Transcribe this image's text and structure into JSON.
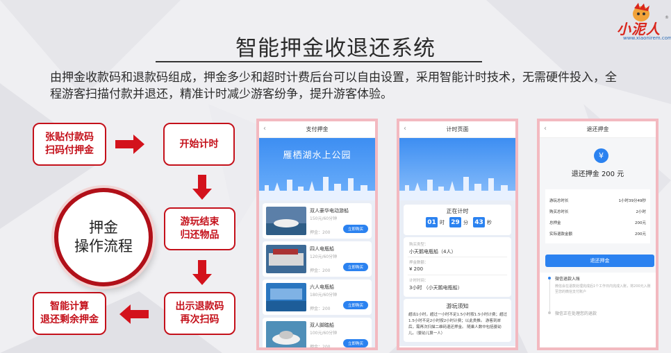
{
  "header": {
    "title": "智能押金收退还系统",
    "description": "由押金收款码和退款码组成，押金多少和超时计费后台可以自由设置，采用智能计时技术，无需硬件投入，全程游客扫描付款并退还，精准计时减少游客纷争，提升游客体验。"
  },
  "logo": {
    "text": "小泥人",
    "url": "www.xiaonirem.com",
    "reg": "®"
  },
  "flow": {
    "center": "押金\n操作流程",
    "step1": "张贴付款码\n扫码付押金",
    "step2": "开始计时",
    "step3": "游玩结束\n归还物品",
    "step4": "出示退款码\n再次扫码",
    "step5": "智能计算\n退还剩余押金"
  },
  "phone1": {
    "header": "支付押金",
    "back": "‹",
    "banner": "雁栖湖水上公园",
    "items": [
      {
        "name": "双人豪华电动游船",
        "price": "150元/60分钟",
        "deposit": "押金：200",
        "button": "立即购买"
      },
      {
        "name": "四人电瓶船",
        "price": "120元/60分钟",
        "deposit": "押金：200",
        "button": "立即购买"
      },
      {
        "name": "六人电瓶船",
        "price": "180元/60分钟",
        "deposit": "押金：200",
        "button": "立即购买"
      },
      {
        "name": "双人脚踏船",
        "price": "100元/60分钟",
        "deposit": "押金：200",
        "button": "立即购买"
      }
    ]
  },
  "phone2": {
    "header": "计时页面",
    "back": "‹",
    "timer_title": "正在计时",
    "hours": "01",
    "h_unit": "时",
    "minutes": "29",
    "m_unit": "分",
    "seconds": "43",
    "s_unit": "秒",
    "type_label": "购买类型：",
    "type_value": "小天鹅电瓶船（4人）",
    "deposit_label": "押金数额：",
    "deposit_value": "¥ 200",
    "time_label": "计时时间：",
    "time_value": "3小时 （小天鹅电瓶船）",
    "notice_title": "游玩须知",
    "notice_body": "超出1小时，超过一小时不足1.5小时按1.5小时计费；超过1.5小时不足2小时按2小时计费；以此类推。 游客到岸后，需再次扫描二维码退还押金。 随乘人数中包括婴幼儿。（婴幼儿算一人）"
  },
  "phone3": {
    "header": "退还押金",
    "back": "‹",
    "currency": "¥",
    "refund_title": "退还押金 200 元",
    "rows": [
      {
        "label": "游玩总时长",
        "value": "1小时39分49秒"
      },
      {
        "label": "购买总时长",
        "value": "2小时"
      },
      {
        "label": "总押金",
        "value": "200元"
      },
      {
        "label": "实际退款金额",
        "value": "200元"
      }
    ],
    "button": "退还押金",
    "step1": "微信退款入账",
    "step1_desc": "微信会在退款处理完成后1个工作日内完成入账，将200元入账至您的微信支付账户",
    "step2": "微信正在处理您的退款"
  },
  "colors": {
    "accent": "#c4101a",
    "blue": "#2b82f0",
    "frame": "#f3b9c0"
  }
}
